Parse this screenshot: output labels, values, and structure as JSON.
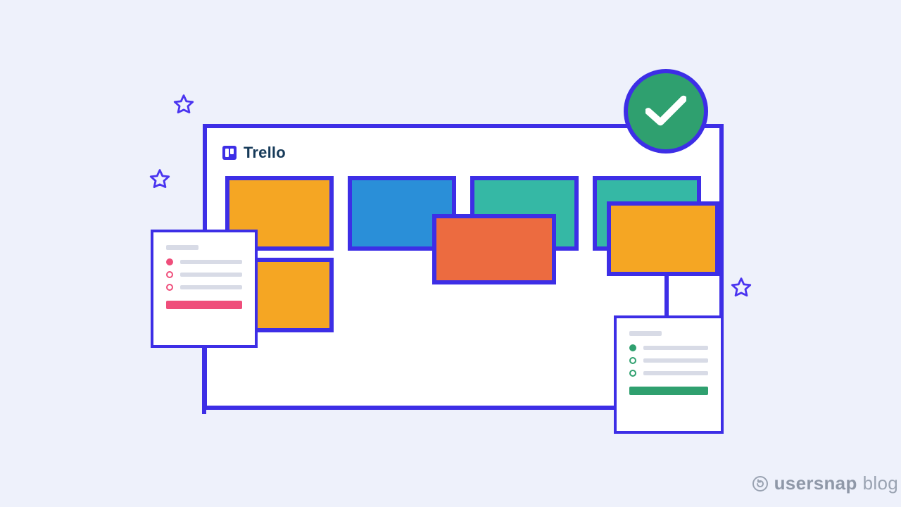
{
  "board": {
    "title": "Trello"
  },
  "badges": {
    "check_label": "done"
  },
  "colors": {
    "stroke": "#3d2ee6",
    "bg": "#eef1fb",
    "orange": "#f5a623",
    "blue": "#2a8fd8",
    "teal": "#35b8a5",
    "orangered": "#ec6b40",
    "green": "#2fa06f",
    "pink": "#ef4e7b",
    "grayline": "#d8dbe6"
  },
  "watermark": {
    "brand_bold": "usersnap",
    "brand_light": "blog"
  }
}
